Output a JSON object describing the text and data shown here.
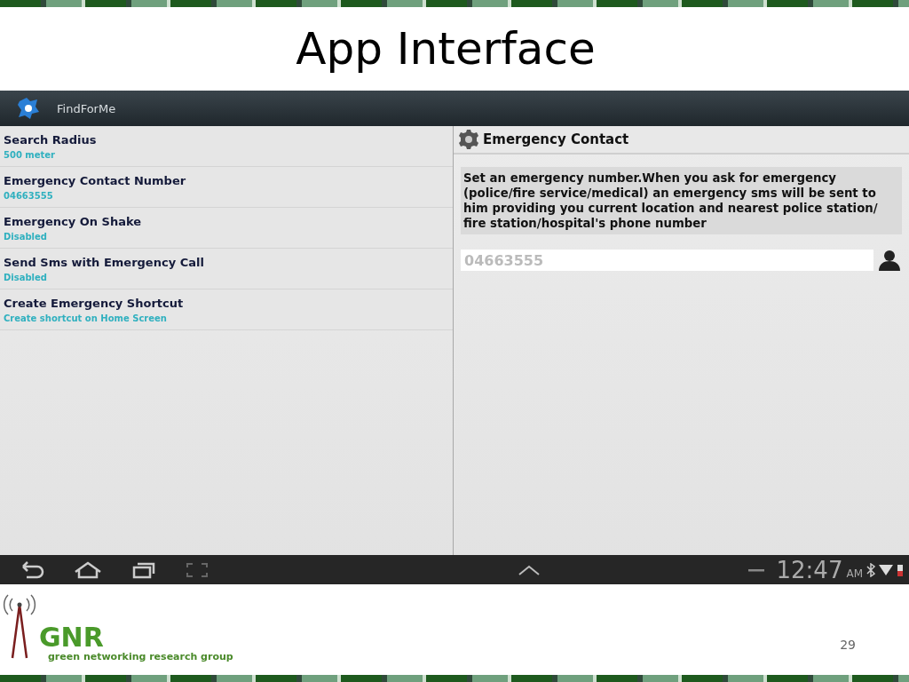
{
  "slide": {
    "title": "App Interface",
    "page_number": "29"
  },
  "app": {
    "title": "FindForMe"
  },
  "settings": [
    {
      "title": "Search Radius",
      "summary": "500 meter"
    },
    {
      "title": "Emergency Contact Number",
      "summary": "04663555"
    },
    {
      "title": "Emergency On Shake",
      "summary": "Disabled"
    },
    {
      "title": "Send Sms with Emergency Call",
      "summary": "Disabled"
    },
    {
      "title": "Create Emergency Shortcut",
      "summary": "Create shortcut on Home Screen"
    }
  ],
  "dialog": {
    "title": "Emergency Contact",
    "message": "Set an emergency number.When you ask for emergency (police/fire service/medical) an emergency sms will be sent to him providing you current location and nearest police station/ fire station/hospital's phone number",
    "input": {
      "placeholder": "04663555"
    }
  },
  "status_bar": {
    "time": "12:47",
    "period": "AM"
  },
  "logo": {
    "mark": "GNR",
    "tagline": "green networking research group"
  }
}
